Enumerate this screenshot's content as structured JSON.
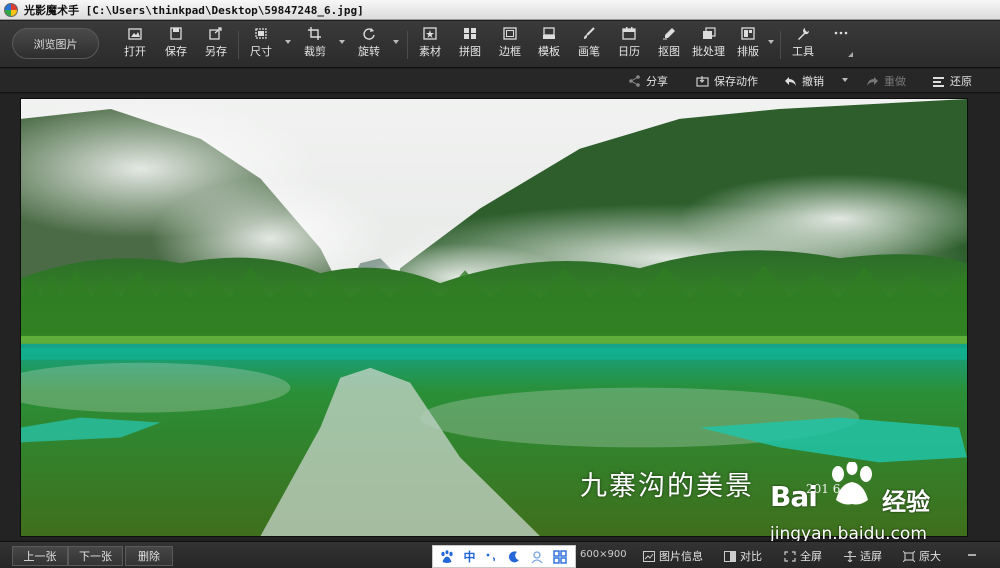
{
  "window": {
    "title": "光影魔术手 [C:\\Users\\thinkpad\\Desktop\\59847248_6.jpg]"
  },
  "toolbar": {
    "browse_label": "浏览图片",
    "tools": [
      {
        "label": "打开",
        "icon": "open-icon"
      },
      {
        "label": "保存",
        "icon": "save-icon"
      },
      {
        "label": "另存",
        "icon": "save-as-icon"
      },
      {
        "label": "尺寸",
        "icon": "resize-icon"
      },
      {
        "label": "裁剪",
        "icon": "crop-icon"
      },
      {
        "label": "旋转",
        "icon": "rotate-icon"
      },
      {
        "label": "素材",
        "icon": "sticker-icon"
      },
      {
        "label": "拼图",
        "icon": "collage-icon"
      },
      {
        "label": "边框",
        "icon": "frame-icon"
      },
      {
        "label": "模板",
        "icon": "template-icon"
      },
      {
        "label": "画笔",
        "icon": "brush-icon"
      },
      {
        "label": "日历",
        "icon": "calendar-icon"
      },
      {
        "label": "抠图",
        "icon": "cutout-icon"
      },
      {
        "label": "批处理",
        "icon": "batch-icon"
      },
      {
        "label": "排版",
        "icon": "layout-icon"
      },
      {
        "label": "工具",
        "icon": "tools-icon"
      },
      {
        "label": "",
        "icon": "more-icon"
      }
    ]
  },
  "actions": {
    "share": "分享",
    "save_action": "保存动作",
    "undo": "撤销",
    "redo": "重做",
    "restore": "还原"
  },
  "photo": {
    "caption": "九寨沟的美景",
    "caption_year": "201 6",
    "watermark_logo": "Bai",
    "watermark_text": "经验",
    "watermark_url": "jingyan.baidu.com",
    "colors": {
      "sky": "#e9ebea",
      "forest": "#2f7d23",
      "lake": "#1aa087"
    }
  },
  "bottom": {
    "prev": "上一张",
    "next": "下一张",
    "delete": "删除",
    "size": "600×900",
    "info": "图片信息",
    "compare": "对比",
    "fullscreen": "全屏",
    "fit": "适屏",
    "original": "原大"
  },
  "ime": {
    "mode": "中"
  }
}
